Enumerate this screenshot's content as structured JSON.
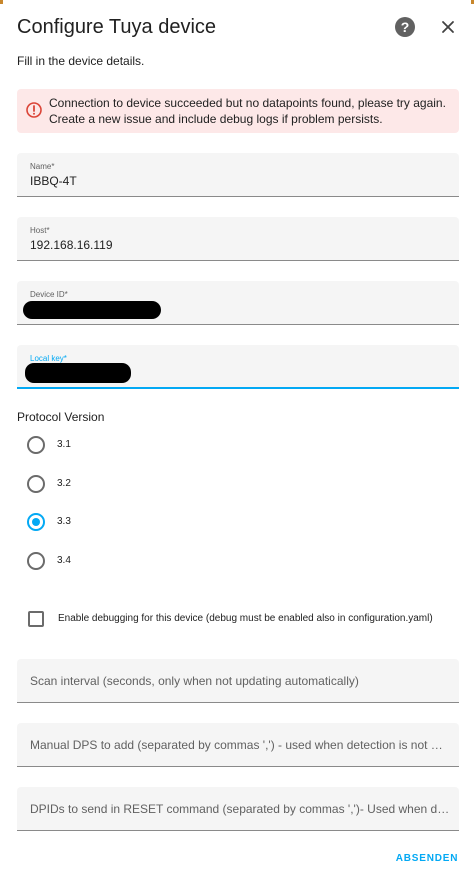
{
  "dialog": {
    "title": "Configure Tuya device",
    "subtitle": "Fill in the device details.",
    "help_icon": "help-circle-icon",
    "close_icon": "close-icon"
  },
  "alert": {
    "icon": "alert-circle-icon",
    "line1": "Connection to device succeeded but no datapoints found, please try again.",
    "line2": "Create a new issue and include debug logs if problem persists.",
    "color": "#fde8e8"
  },
  "fields": {
    "name": {
      "label": "Name*",
      "value": "IBBQ-4T"
    },
    "host": {
      "label": "Host*",
      "value": "192.168.16.119"
    },
    "device_id": {
      "label": "Device ID*"
    },
    "local_key": {
      "label": "Local key*"
    }
  },
  "protocol": {
    "label": "Protocol Version",
    "options": [
      "3.1",
      "3.2",
      "3.3",
      "3.4"
    ],
    "selected": "3.3"
  },
  "debug": {
    "label": "Enable debugging for this device (debug must be enabled also in configuration.yaml)",
    "checked": false
  },
  "optional_fields": {
    "scan_interval": {
      "placeholder": "Scan interval (seconds, only when not updating automatically)"
    },
    "manual_dps": {
      "placeholder": "Manual DPS to add (separated by commas ',') - used when detection is not working (optional)"
    },
    "reset_dpids": {
      "placeholder": "DPIDs to send in RESET command (separated by commas ',')- Used when device does not respond"
    }
  },
  "actions": {
    "submit_label": "ABSENDEN"
  },
  "colors": {
    "accent": "#03a9f4",
    "error_bg": "#fde8e8",
    "error_icon": "#db4437"
  }
}
